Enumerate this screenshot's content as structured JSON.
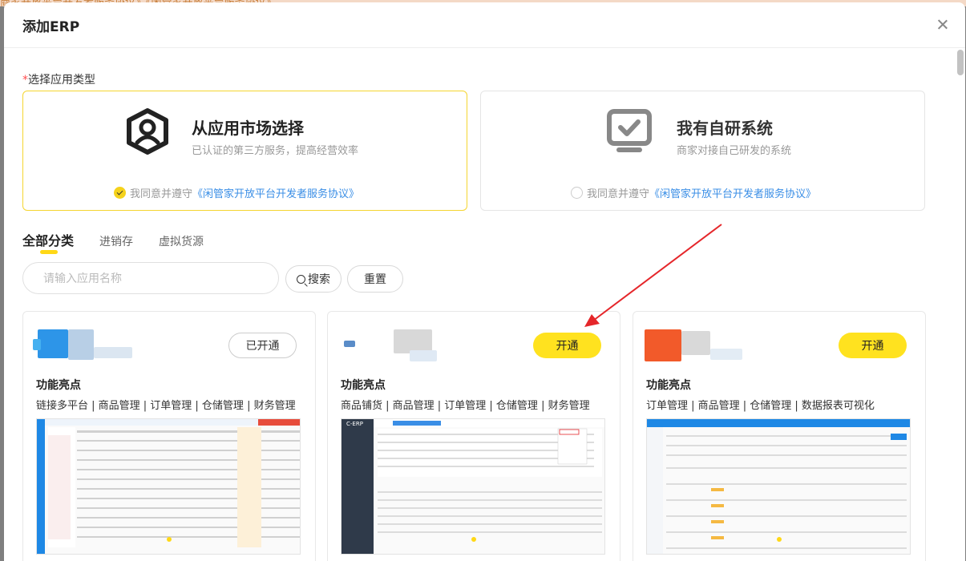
{
  "background_text": "商家开放平台开发者服务协议》《闲管家开放平台服务协议》",
  "modal": {
    "title": "添加ERP"
  },
  "section_label": {
    "required": "*",
    "text": "选择应用类型"
  },
  "type_cards": [
    {
      "title": "从应用市场选择",
      "desc": "已认证的第三方服务，提高经营效率",
      "agree_prefix": "我同意并遵守",
      "agree_link": "《闲管家开放平台开发者服务协议》",
      "checked": true
    },
    {
      "title": "我有自研系统",
      "desc": "商家对接自己研发的系统",
      "agree_prefix": "我同意并遵守",
      "agree_link": "《闲管家开放平台开发者服务协议》",
      "checked": false
    }
  ],
  "tabs": [
    "全部分类",
    "进销存",
    "虚拟货源"
  ],
  "search": {
    "placeholder": "请输入应用名称",
    "search_label": "搜索",
    "reset_label": "重置"
  },
  "apps": [
    {
      "button": "已开通",
      "button_state": "opened",
      "feature_title": "功能亮点",
      "features": "链接多平台 | 商品管理 | 订单管理 | 仓储管理 | 财务管理"
    },
    {
      "button": "开通",
      "button_state": "open",
      "feature_title": "功能亮点",
      "features": "商品铺货 | 商品管理 | 订单管理 | 仓储管理 | 财务管理",
      "screenshot_label": "C-ERP"
    },
    {
      "button": "开通",
      "button_state": "open",
      "feature_title": "功能亮点",
      "features": "订单管理 | 商品管理 | 仓储管理 | 数据报表可视化"
    }
  ],
  "colors": {
    "accent_yellow": "#ffe21f",
    "link_blue": "#3a8ee6",
    "arrow_red": "#e5262a"
  }
}
